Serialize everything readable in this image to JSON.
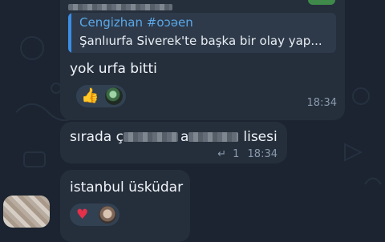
{
  "messages": [
    {
      "reply": {
        "author": "Cengizhan #oɔəen",
        "text": "Şanlıurfa Siverek'te başka bir olay yap..."
      },
      "text": "yok urfa bitti",
      "time": "18:34",
      "reactions": [
        "thumbs-up-emoji",
        "user-avatar-reaction"
      ]
    },
    {
      "text_before": "sırada ç",
      "text_mid": "a",
      "text_after": "lisesi",
      "reply_count": "1",
      "time": "18:34"
    },
    {
      "text": "istanbul üsküdar",
      "reactions": [
        "heart-emoji",
        "user-avatar-reaction"
      ]
    }
  ],
  "colors": {
    "background": "#1b2430",
    "bubble": "#252f3c",
    "reply_author": "#5aa8e8",
    "reply_bar": "#3a8ee6",
    "meta_text": "#8a99ab",
    "reaction_pill": "#324152",
    "top_badge": "#3f8a4a"
  }
}
